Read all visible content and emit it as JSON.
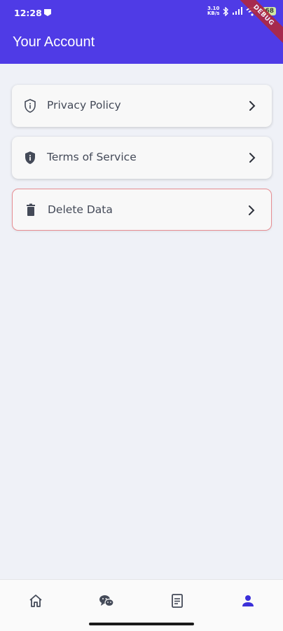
{
  "status_bar": {
    "time": "12:28",
    "rate_value": "3.10",
    "rate_unit": "KB/s",
    "battery": "68"
  },
  "debug_banner": "DEBUG",
  "header": {
    "title": "Your Account"
  },
  "menu": {
    "items": [
      {
        "label": "Privacy Policy",
        "icon": "shield-info-outline-icon"
      },
      {
        "label": "Terms of Service",
        "icon": "shield-info-filled-icon"
      },
      {
        "label": "Delete Data",
        "icon": "trash-icon"
      }
    ]
  },
  "bottom_nav": {
    "items": [
      {
        "icon": "home-icon",
        "active": false
      },
      {
        "icon": "chat-bubbles-icon",
        "active": false
      },
      {
        "icon": "document-icon",
        "active": false
      },
      {
        "icon": "person-icon",
        "active": true
      }
    ]
  },
  "colors": {
    "primary": "#4f3be6",
    "background": "#eff1f7",
    "danger_border": "#e78d92",
    "nav_active": "#3b2fd9",
    "nav_inactive": "#444a58"
  }
}
